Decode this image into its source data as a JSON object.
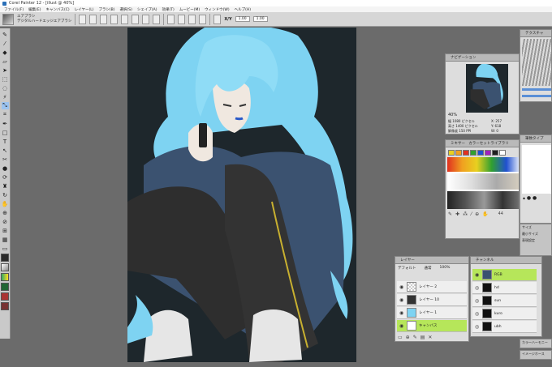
{
  "window": {
    "title": "Corel Painter 12 - [illust @ 40%]"
  },
  "menu": [
    "ファイル(F)",
    "編集(E)",
    "キャンバス(C)",
    "レイヤー(L)",
    "ブラシ(B)",
    "選択(S)",
    "シェイプ(A)",
    "効果(T)",
    "ムービー(M)",
    "ウィンドウ(W)",
    "ヘルプ(H)"
  ],
  "property_bar": {
    "brush_category": "エアブラシ",
    "brush_variant": "デジタルハードエッジエアブラシ",
    "xy_label": "X/Y",
    "x_value": "1.00",
    "y_value": "1.00"
  },
  "navigator": {
    "title": "ナビゲーション",
    "zoom": "40%",
    "width_label": "幅",
    "width_value": "1080 ピクセル",
    "height_label": "高さ",
    "height_value": "1400 ピクセル",
    "res_label": "解像度",
    "res_value": "150 PPI",
    "x_label": "X:",
    "x_value": "257",
    "y_label": "Y:",
    "y_value": "618",
    "w_label": "W:",
    "w_value": "0",
    "h_label": "H:",
    "h_value": "0"
  },
  "texture_panel": {
    "title": "テクスチャ"
  },
  "mixer_panel": {
    "tabs": [
      "ミキサー",
      "カラーセットライブラリ"
    ],
    "swatches": [
      "#e8d020",
      "#f0a020",
      "#e03020",
      "#30a030",
      "#2050d0",
      "#a020c0",
      "#202020",
      "#ffffff"
    ],
    "size_value": "44"
  },
  "brush_dynamics": {
    "title": "筆致タイプ"
  },
  "layers": {
    "title": "レイヤー",
    "composite": "デフォルト",
    "composite_mode": "通常",
    "opacity": "100%",
    "items": [
      {
        "name": "レイヤー 2",
        "selected": false
      },
      {
        "name": "レイヤー 10",
        "selected": false
      },
      {
        "name": "レイヤー 1",
        "selected": false
      },
      {
        "name": "キャンバス",
        "selected": true
      }
    ]
  },
  "channels": {
    "title": "チャンネル",
    "items": [
      {
        "name": "RGB",
        "selected": true
      },
      {
        "name": "hd",
        "selected": false
      },
      {
        "name": "sun",
        "selected": false
      },
      {
        "name": "kuro",
        "selected": false
      },
      {
        "name": "ubh",
        "selected": false
      }
    ]
  },
  "side_labels": {
    "size": "サイズ",
    "min": "最小サイズ",
    "expr": "表現設定",
    "color_harmony": "カラーハーモニー",
    "image_hose": "イメージホース"
  },
  "colors": {
    "canvas_bg": "#1e272c",
    "hair": "#7ed3f2",
    "hoodie": "#3b5270",
    "pants": "#2e2e2e",
    "selected_row": "#b6e65a",
    "workspace": "#6b6b6b"
  }
}
